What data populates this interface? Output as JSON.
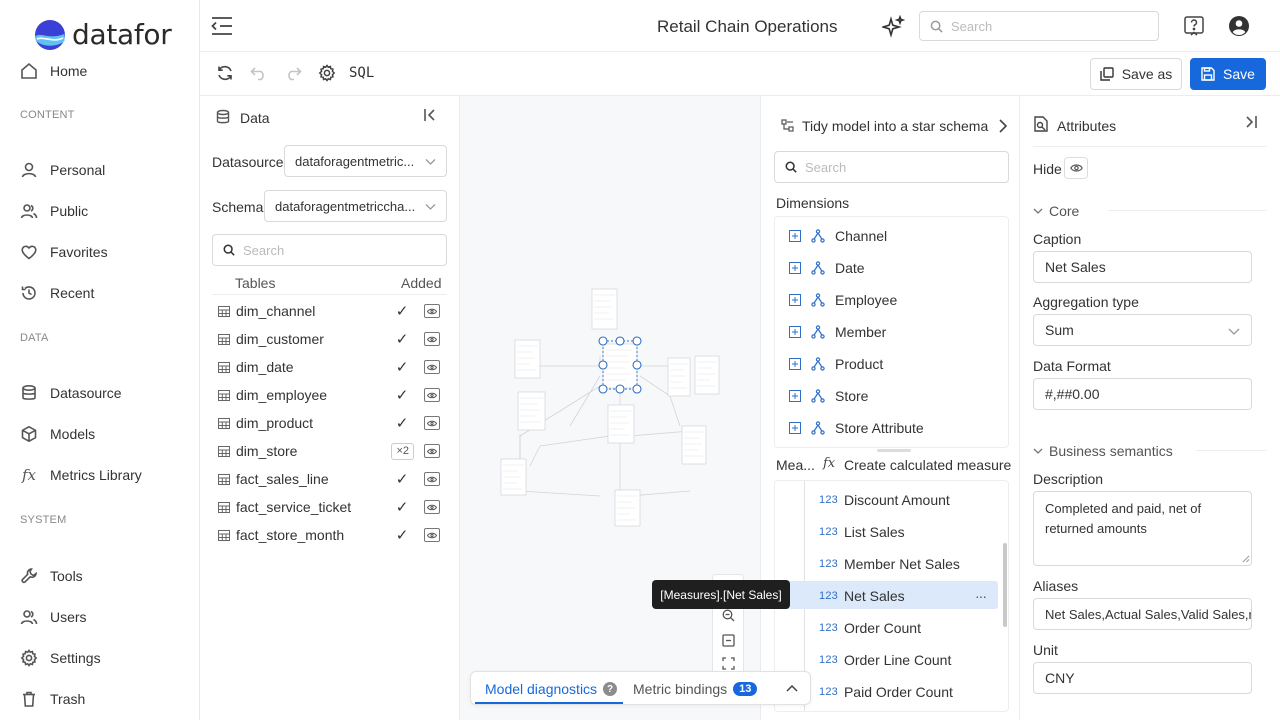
{
  "app": {
    "brand": "datafor",
    "title": "Retail Chain Operations"
  },
  "header": {
    "search_placeholder": "Search"
  },
  "toolbar": {
    "sql_label": "SQL",
    "save_as_label": "Save as",
    "save_label": "Save"
  },
  "nav": {
    "home": "Home",
    "sections": {
      "content": "CONTENT",
      "data": "DATA",
      "system": "SYSTEM"
    },
    "items": {
      "personal": "Personal",
      "public": "Public",
      "favorites": "Favorites",
      "recent": "Recent",
      "datasource": "Datasource",
      "models": "Models",
      "metrics": "Metrics Library",
      "tools": "Tools",
      "users": "Users",
      "settings": "Settings",
      "trash": "Trash"
    },
    "fx_glyph": "fx"
  },
  "data_panel": {
    "title": "Data",
    "datasource_label": "Datasource",
    "datasource_value": "dataforagentmetric...",
    "schema_label": "Schema",
    "schema_value": "dataforagentmetriccha...",
    "search_placeholder": "Search",
    "col_tables": "Tables",
    "col_added": "Added",
    "tables": [
      {
        "name": "dim_channel",
        "mark": "✓"
      },
      {
        "name": "dim_customer",
        "mark": "✓"
      },
      {
        "name": "dim_date",
        "mark": "✓"
      },
      {
        "name": "dim_employee",
        "mark": "✓"
      },
      {
        "name": "dim_product",
        "mark": "✓"
      },
      {
        "name": "dim_store",
        "mark": "×2"
      },
      {
        "name": "fact_sales_line",
        "mark": "✓"
      },
      {
        "name": "fact_service_ticket",
        "mark": "✓"
      },
      {
        "name": "fact_store_month",
        "mark": "✓"
      }
    ]
  },
  "fields_panel": {
    "tidy_label": "Tidy model into a star schema",
    "search_placeholder": "Search",
    "dimensions_title": "Dimensions",
    "dimensions": [
      "Channel",
      "Date",
      "Employee",
      "Member",
      "Product",
      "Store",
      "Store Attribute"
    ],
    "measures_tab": "Mea...",
    "fx_glyph": "fx",
    "create_calc": "Create calculated measure",
    "num_badge": "123",
    "measures": [
      "Discount Amount",
      "List Sales",
      "Member Net Sales",
      "Net Sales",
      "Order Count",
      "Order Line Count",
      "Paid Order Count"
    ],
    "selected_measure": "Net Sales",
    "more_glyph": "···"
  },
  "tooltip": "[Measures].[Net Sales]",
  "bottom": {
    "model_diagnostics": "Model diagnostics",
    "help_glyph": "?",
    "metric_bindings": "Metric bindings",
    "bindings_count": "13"
  },
  "attributes": {
    "title": "Attributes",
    "hide_label": "Hide",
    "core_section": "Core",
    "caption_label": "Caption",
    "caption_value": "Net Sales",
    "agg_label": "Aggregation type",
    "agg_value": "Sum",
    "format_label": "Data Format",
    "format_value": "#,##0.00",
    "business_section": "Business semantics",
    "description_label": "Description",
    "description_value": "Completed and paid, net of returned amounts",
    "aliases_label": "Aliases",
    "aliases_value": "Net Sales,Actual Sales,Valid Sales,r",
    "unit_label": "Unit",
    "unit_value": "CNY"
  },
  "colors": {
    "accent": "#1668dc",
    "selected_row": "#dbe9fb",
    "tooltip_bg": "#1f1f1f"
  }
}
